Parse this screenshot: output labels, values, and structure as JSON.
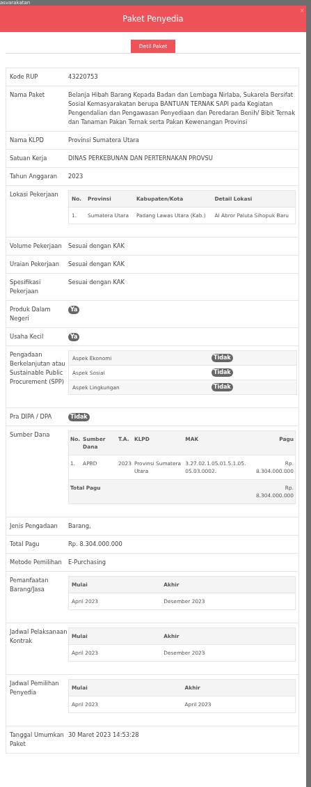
{
  "background_text": "asvarakatan",
  "modal": {
    "title": "Paket Penyedia",
    "close": "×"
  },
  "tabs": [
    {
      "label": "Detil Paket",
      "selected": true
    }
  ],
  "rows": [
    {
      "label": "Kode RUP",
      "kind": "text",
      "value": "43220753"
    },
    {
      "label": "Nama Paket",
      "kind": "text",
      "value": "Belanja Hibah Barang Kepada Badan dan Lembaga Nirlaba, Sukarela Bersifat Sosial Kemasyarakatan berupa BANTUAN TERNAK SAPI pada Kegiatan Pengendalian dan Pengawasan Penyediaan dan Peredaran Benih/ Bibit Ternak dan Tanaman Pakan Ternak serta Pakan Kewenangan Provinsi"
    },
    {
      "label": "Nama KLPD",
      "kind": "text",
      "value": "Provinsi Sumatera Utara"
    },
    {
      "label": "Satuan Kerja",
      "kind": "text",
      "value": "DINAS PERKEBUNAN DAN PERTERNAKAN PROVSU"
    },
    {
      "label": "Tahun Anggaran",
      "kind": "text",
      "value": "2023"
    },
    {
      "label": "Lokasi Pekerjaan",
      "kind": "table",
      "columns": [
        "No.",
        "Provinsi",
        "Kabupaten/Kota",
        "Detail Lokasi"
      ],
      "cells": [
        [
          "1.",
          "Sumatera Utara",
          "Padang Lawas Utara (Kab.)",
          "Al Abror Paluta Sihopuk Baru"
        ]
      ]
    },
    {
      "label": "Volume Pekerjaan",
      "kind": "text",
      "value": "Sesuai dengan KAK"
    },
    {
      "label": "Uraian Pekerjaan",
      "kind": "text",
      "value": "Sesuai dengan KAK"
    },
    {
      "label": "Spesifikasi Pekerjaan",
      "kind": "text",
      "value": "Sesuai dengan KAK"
    },
    {
      "label": "Produk Dalam Negeri",
      "kind": "badge",
      "value": "Ya"
    },
    {
      "label": "Usaha Kecil",
      "kind": "badge",
      "value": "Ya"
    },
    {
      "label": "Pengadaan Berkelanjutan atau Sustainable Public Procurement (SPP)",
      "kind": "aspects",
      "items": [
        {
          "name": "Aspek Ekonomi",
          "value": "Tidak"
        },
        {
          "name": "Aspek Sosial",
          "value": "Tidak"
        },
        {
          "name": "Aspek Lingkungan",
          "value": "Tidak"
        }
      ]
    },
    {
      "label": "Pra DIPA / DPA",
      "kind": "badge",
      "value": "Tidak"
    },
    {
      "label": "Sumber Dana",
      "kind": "table",
      "columns": [
        "No.",
        "Sumber Dana",
        "T.A.",
        "KLPD",
        "MAK",
        "Pagu"
      ],
      "cells": [
        [
          "1.",
          "APBD",
          "2023",
          "Provinsi Sumatera Utara",
          "3.27.02.1.05.01.5.1.05.05.03.0002.",
          "Rp. 8.304.000.000"
        ]
      ],
      "footer": [
        "Total Pagu",
        "Rp. 8.304.000.000"
      ]
    },
    {
      "label": "Jenis Pengadaan",
      "kind": "text",
      "value": "Barang,"
    },
    {
      "label": "Total Pagu",
      "kind": "text",
      "value": "Rp. 8.304.000.000"
    },
    {
      "label": "Metode Pemilihan",
      "kind": "text",
      "value": "E-Purchasing"
    },
    {
      "label": "Pemanfaatan Barang/Jasa",
      "kind": "table",
      "columns": [
        "Mulai",
        "Akhir"
      ],
      "cells": [
        [
          "April 2023",
          "Desember 2023"
        ]
      ]
    },
    {
      "label": "Jadwal Pelaksanaan Kontrak",
      "kind": "table",
      "columns": [
        "Mulai",
        "Akhir"
      ],
      "cells": [
        [
          "April 2023",
          "Desember 2023"
        ]
      ]
    },
    {
      "label": "Jadwal Pemilihan Penyedia",
      "kind": "table",
      "columns": [
        "Mulai",
        "Akhir"
      ],
      "cells": [
        [
          "April 2023",
          "April 2023"
        ]
      ]
    },
    {
      "label": "Tanggal Umumkan Paket",
      "kind": "text",
      "value": "30 Maret 2023 14:53:28"
    }
  ]
}
